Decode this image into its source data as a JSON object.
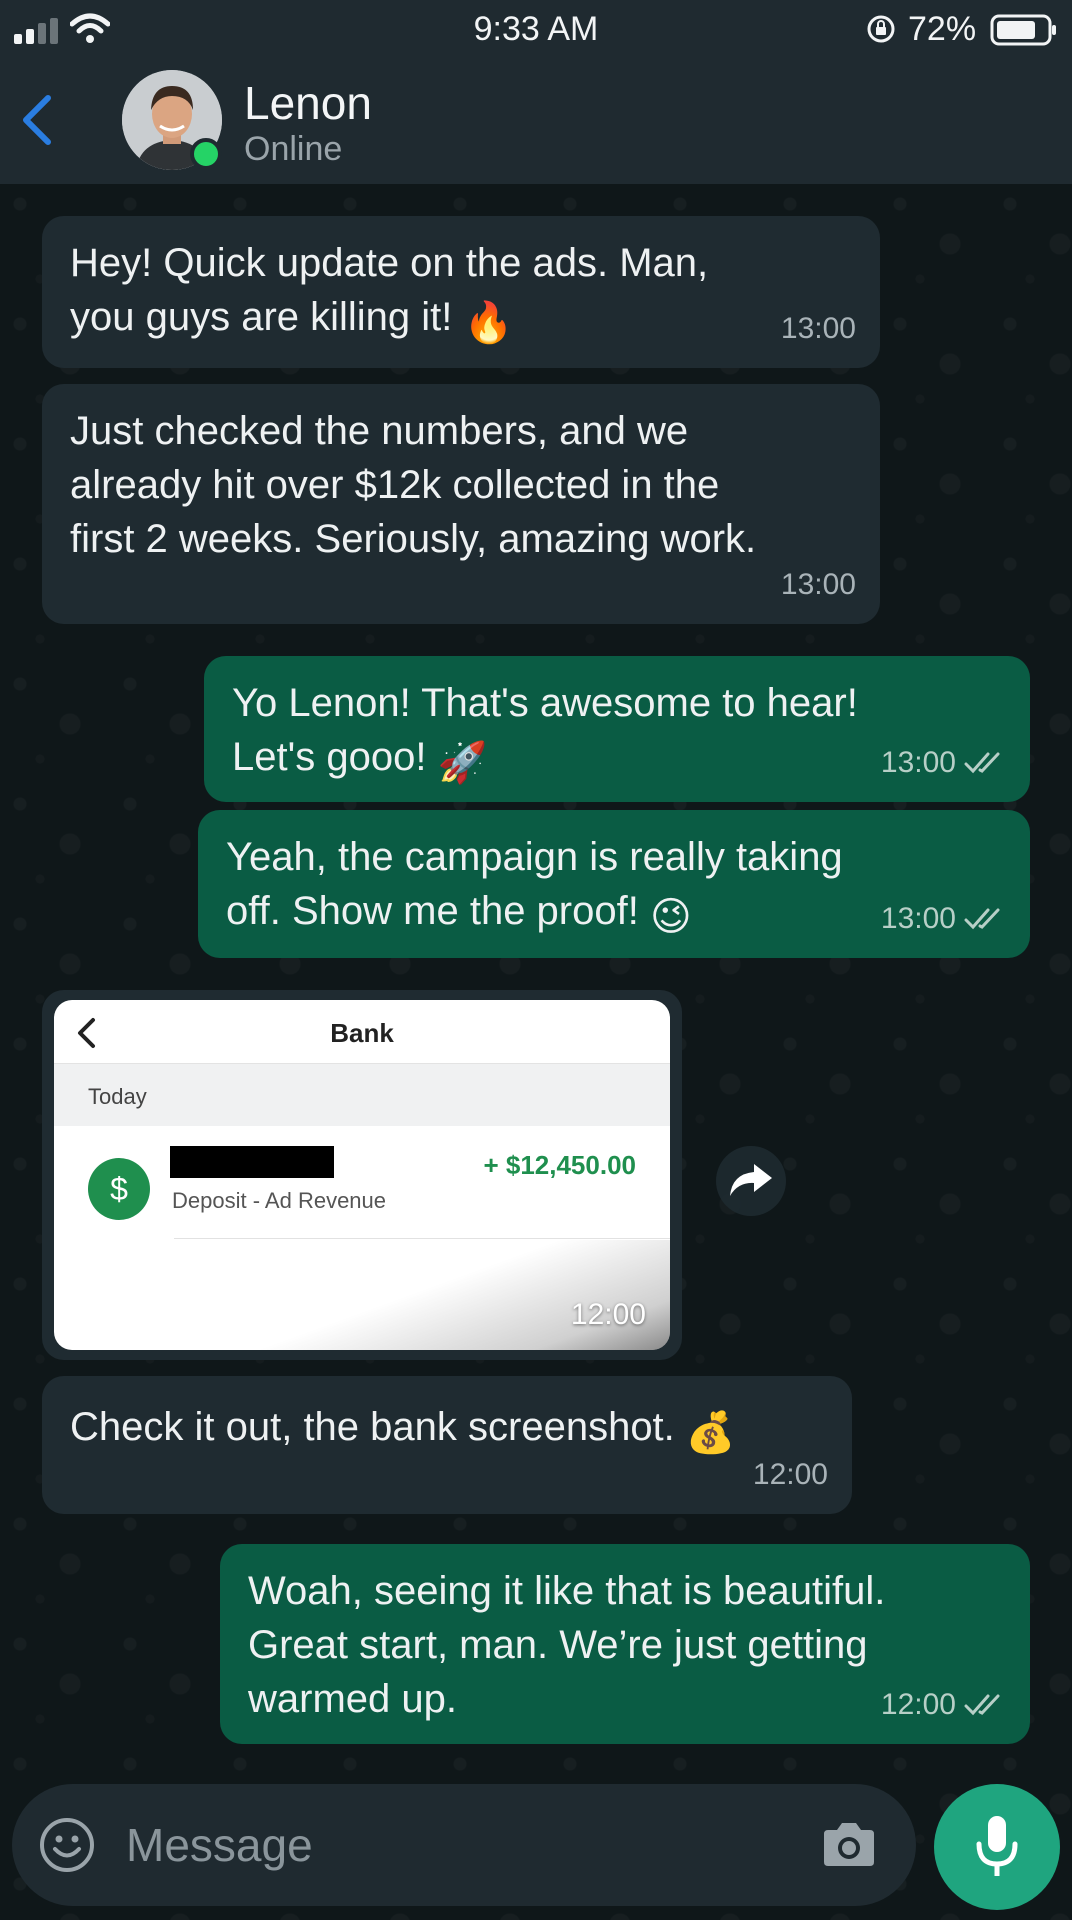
{
  "status_bar": {
    "time": "9:33 AM",
    "battery": "72%",
    "icons": [
      "signal-icon",
      "wifi-icon",
      "orientation-lock-icon",
      "battery-icon"
    ]
  },
  "header": {
    "back_icon": "chevron-left-icon",
    "contact_name": "Lenon",
    "contact_status": "Online",
    "accent_color": "#2a7de1",
    "online_color": "#25d366"
  },
  "messages": [
    {
      "direction": "incoming",
      "text_lines": [
        "Hey! Quick update on the ads. Man,",
        "you guys are killing it!"
      ],
      "emoji": "🔥",
      "time": "13:00"
    },
    {
      "direction": "incoming",
      "text_lines": [
        "Just checked the numbers, and we",
        "already hit over $12k collected in the",
        "first 2 weeks. Seriously, amazing work."
      ],
      "time": "13:00"
    },
    {
      "direction": "outgoing",
      "text_lines": [
        "Yo Lenon! That's awesome to hear!",
        "Let's gooo!"
      ],
      "emoji": "🚀",
      "time": "13:00",
      "read": true
    },
    {
      "direction": "outgoing",
      "text_lines": [
        "Yeah, the campaign is really taking",
        "off. Show me the proof!"
      ],
      "emoji": "😉",
      "time": "13:00",
      "read": true
    },
    {
      "direction": "incoming",
      "type": "image",
      "time": "12:00",
      "image": {
        "title": "Bank",
        "section": "Today",
        "transaction_icon": "$",
        "transaction_description": "Deposit - Ad Revenue",
        "transaction_amount": "+ $12,450.00",
        "amount_color": "#1f8f4e"
      }
    },
    {
      "direction": "incoming",
      "text_lines": [
        "Check it out, the bank screenshot."
      ],
      "emoji": "💰",
      "time": "12:00"
    },
    {
      "direction": "outgoing",
      "text_lines": [
        "Woah, seeing it like that is beautiful.",
        "Great start, man. We’re just getting",
        "warmed up."
      ],
      "time": "12:00",
      "read": true
    }
  ],
  "input": {
    "placeholder": "Message",
    "icons": [
      "smiley-icon",
      "camera-icon",
      "microphone-icon"
    ]
  },
  "colors": {
    "incoming_bubble": "#1f2b31",
    "outgoing_bubble": "#0a5c44",
    "mic_button": "#1fa57f"
  }
}
